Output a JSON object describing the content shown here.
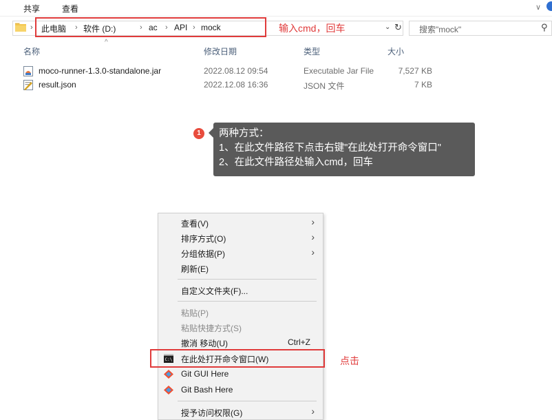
{
  "ribbon": {
    "tabs": [
      "共享",
      "查看"
    ]
  },
  "address_bar": {
    "crumbs": [
      "此电脑",
      "软件 (D:)",
      "ac",
      "API",
      "mock"
    ],
    "separator": "›",
    "annotation": "输入cmd，回车"
  },
  "search": {
    "placeholder": "搜索\"mock\""
  },
  "columns": {
    "name": "名称",
    "date": "修改日期",
    "type": "类型",
    "size": "大小"
  },
  "files": [
    {
      "name": "moco-runner-1.3.0-standalone.jar",
      "date": "2022.08.12 09:54",
      "type": "Executable Jar File",
      "size": "7,527 KB",
      "icon": "jar-file-icon"
    },
    {
      "name": "result.json",
      "date": "2022.12.08 16:36",
      "type": "JSON 文件",
      "size": "7 KB",
      "icon": "json-file-icon"
    }
  ],
  "tooltip": {
    "badge": "1",
    "lines": [
      "两种方式：",
      "1、在此文件路径下点击右键\"在此处打开命令窗口\"",
      "2、在此文件路径处输入cmd，回车"
    ]
  },
  "context_menu": {
    "view": "查看(V)",
    "sort_by": "排序方式(O)",
    "group_by": "分组依据(P)",
    "refresh": "刷新(E)",
    "customize_folder": "自定义文件夹(F)...",
    "paste": "粘贴(P)",
    "paste_shortcut": "粘贴快捷方式(S)",
    "undo_move": "撤消 移动(U)",
    "undo_shortcut": "Ctrl+Z",
    "open_cmd": "在此处打开命令窗口(W)",
    "git_gui": "Git GUI Here",
    "git_bash": "Git Bash Here",
    "grant_access": "授予访问权限(G)",
    "annotation": "点击"
  },
  "colors": {
    "annotation_red": "#e03a3a",
    "tooltip_bg": "#5a5a5a",
    "badge_red": "#e84c3d",
    "git_orange": "#f05033"
  }
}
